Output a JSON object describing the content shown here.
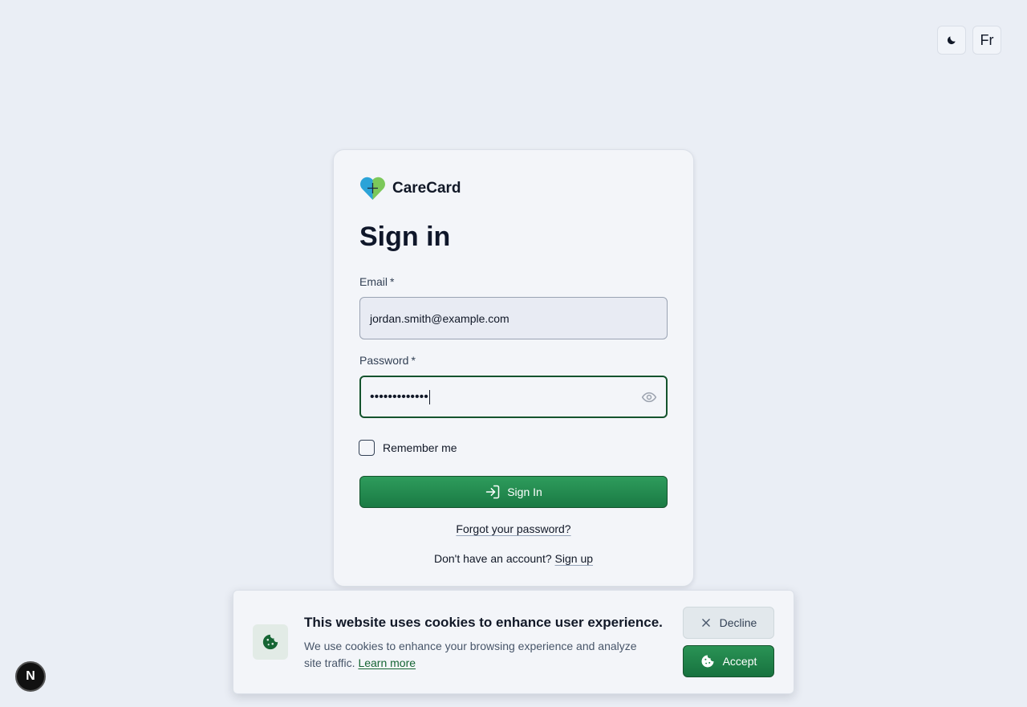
{
  "top_controls": {
    "theme_toggle_icon": "moon-icon",
    "language_label": "Fr"
  },
  "brand": {
    "name": "CareCard",
    "logo_icon": "heart-plus-icon"
  },
  "form": {
    "title": "Sign in",
    "email_label": "Email",
    "email_value": "jordan.smith@example.com",
    "password_label": "Password",
    "required_marker": "*",
    "password_masked": "•••••••••••••",
    "show_password_icon": "eye-icon",
    "remember_label": "Remember me",
    "signin_label": "Sign In",
    "signin_icon": "login-icon",
    "forgot_label": "Forgot your password?",
    "signup_prompt": "Don't have an account?",
    "signup_label": "Sign up"
  },
  "cookie_banner": {
    "icon": "cookie-icon",
    "title": "This website uses cookies to enhance user experience.",
    "text": "We use cookies to enhance your browsing experience and analyze site traffic.",
    "learn_more": "Learn more",
    "decline_label": "Decline",
    "accept_label": "Accept"
  },
  "dev_badge": {
    "label": "N"
  },
  "colors": {
    "primary": "#1f8a4c",
    "primary_dark": "#14532d",
    "background": "#eaeef5",
    "card": "#f3f5f9"
  }
}
